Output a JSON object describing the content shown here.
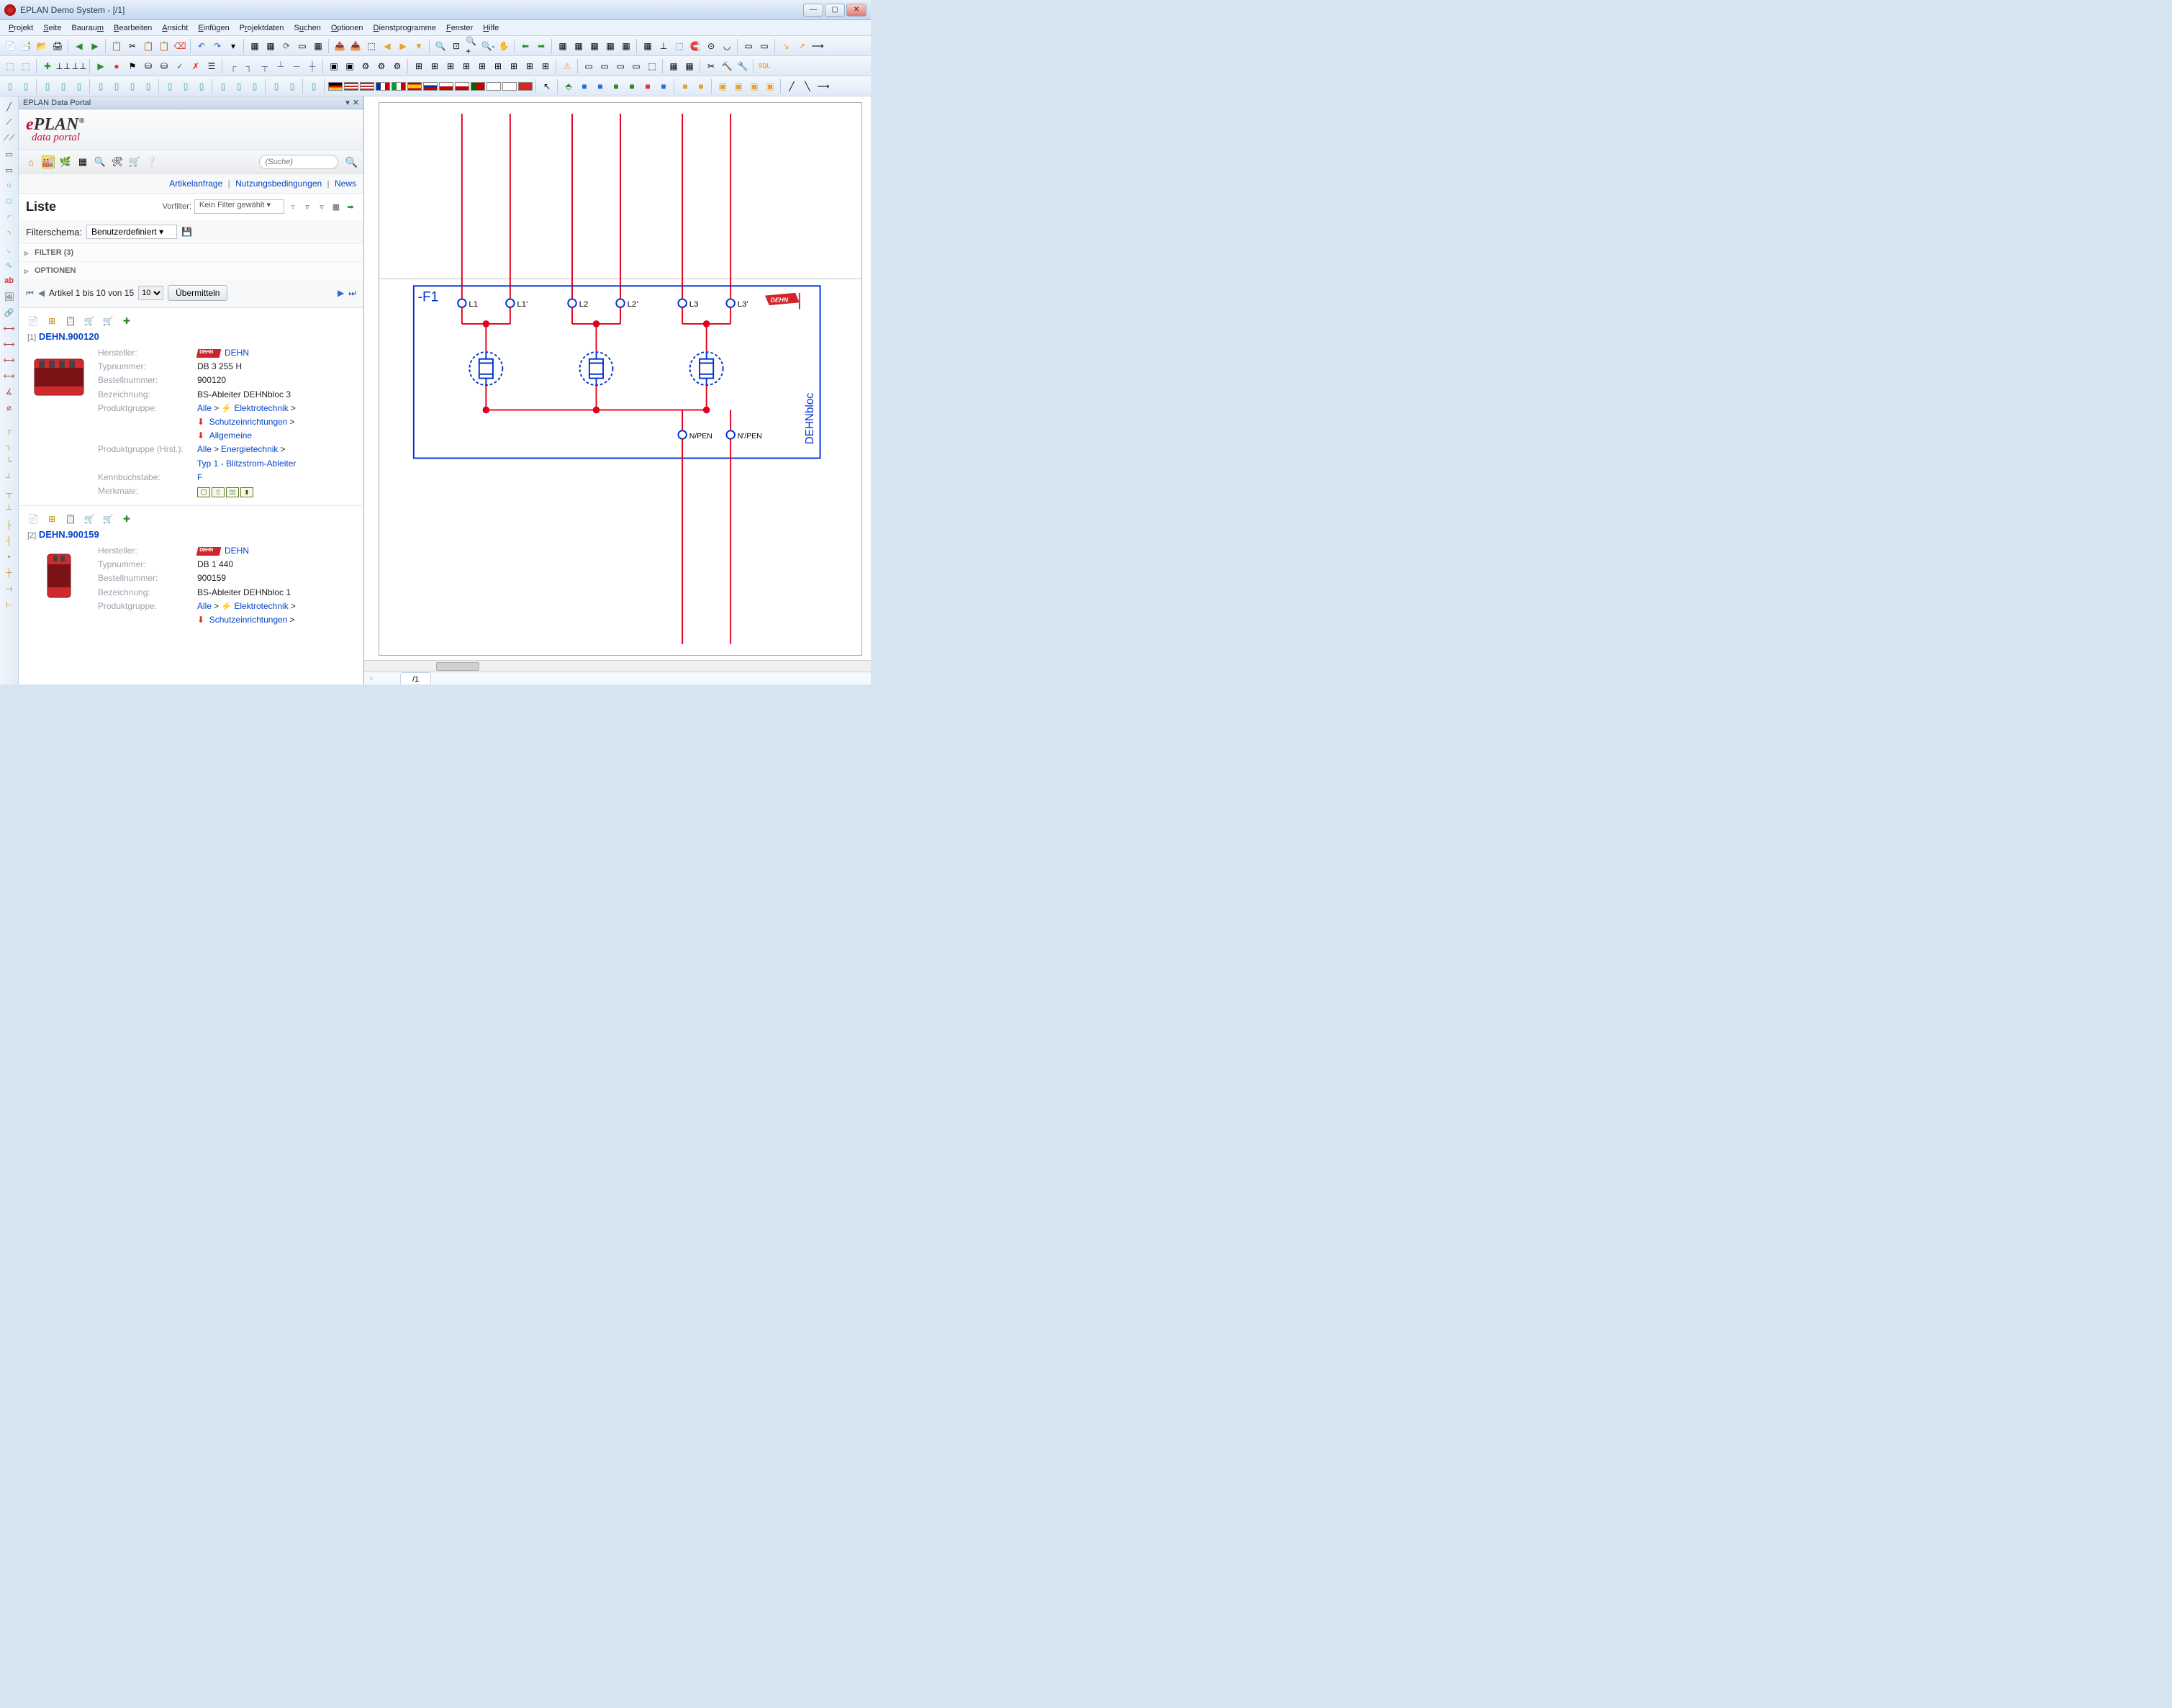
{
  "titlebar": {
    "text": "EPLAN Demo System - [/1]"
  },
  "menu": [
    "Projekt",
    "Seite",
    "Bauraum",
    "Bearbeiten",
    "Ansicht",
    "Einfügen",
    "Projektdaten",
    "Suchen",
    "Optionen",
    "Dienstprogramme",
    "Fenster",
    "Hilfe"
  ],
  "panel": {
    "title": "EPLAN Data Portal",
    "brand_top": "PLAN",
    "brand_reg": "®",
    "brand_sub": "data portal",
    "search_placeholder": "(Suche)",
    "links": {
      "req": "Artikelanfrage",
      "terms": "Nutzungsbedingungen",
      "news": "News"
    },
    "list_heading": "Liste",
    "prefilter_label": "Vorfilter:",
    "prefilter_value": "Kein Filter gewählt",
    "filterschema_label": "Filterschema:",
    "filterschema_value": "Benutzerdefiniert",
    "filter_exp": "FILTER (3)",
    "options_exp": "OPTIONEN",
    "pager_info": "Artikel 1 bis 10 von 15",
    "pager_size": "10",
    "pager_submit": "Übermitteln"
  },
  "items": [
    {
      "idx": "[1]",
      "code": "DEHN.900120",
      "rows": {
        "hersteller_lbl": "Hersteller:",
        "hersteller_val": "DEHN",
        "typ_lbl": "Typnummer:",
        "typ_val": "DB 3 255 H",
        "bestell_lbl": "Bestellnummer:",
        "bestell_val": "900120",
        "bez_lbl": "Bezeichnung:",
        "bez_val": "BS-Ableiter DEHNbloc 3",
        "pg_lbl": "Produktgruppe:",
        "pg_alle": "Alle",
        "pg_elek": "Elektrotechnik",
        "pg_schutz": "Schutzeinrichtungen",
        "pg_allg": "Allgemeine",
        "pgh_lbl": "Produktgruppe (Hrst.):",
        "pgh_alle": "Alle",
        "pgh_energie": "Energietechnik",
        "pgh_typ1": "Typ 1 - Blitzstrom-Ableiter",
        "kenn_lbl": "Kennbuchstabe:",
        "kenn_val": "F",
        "merk_lbl": "Merkmale:"
      }
    },
    {
      "idx": "[2]",
      "code": "DEHN.900159",
      "rows": {
        "hersteller_lbl": "Hersteller:",
        "hersteller_val": "DEHN",
        "typ_lbl": "Typnummer:",
        "typ_val": "DB 1 440",
        "bestell_lbl": "Bestellnummer:",
        "bestell_val": "900159",
        "bez_lbl": "Bezeichnung:",
        "bez_val": "BS-Ableiter DEHNbloc 1",
        "pg_lbl": "Produktgruppe:",
        "pg_alle": "Alle",
        "pg_elek": "Elektrotechnik",
        "pg_schutz": "Schutzeinrichtungen"
      }
    }
  ],
  "schematic": {
    "device_tag": "-F1",
    "terminals": [
      "L1",
      "L1'",
      "L2",
      "L2'",
      "L3",
      "L3'",
      "N/PEN",
      "N'/PEN"
    ],
    "block_label": "DEHNbloc"
  },
  "tab": {
    "name": "/1"
  }
}
